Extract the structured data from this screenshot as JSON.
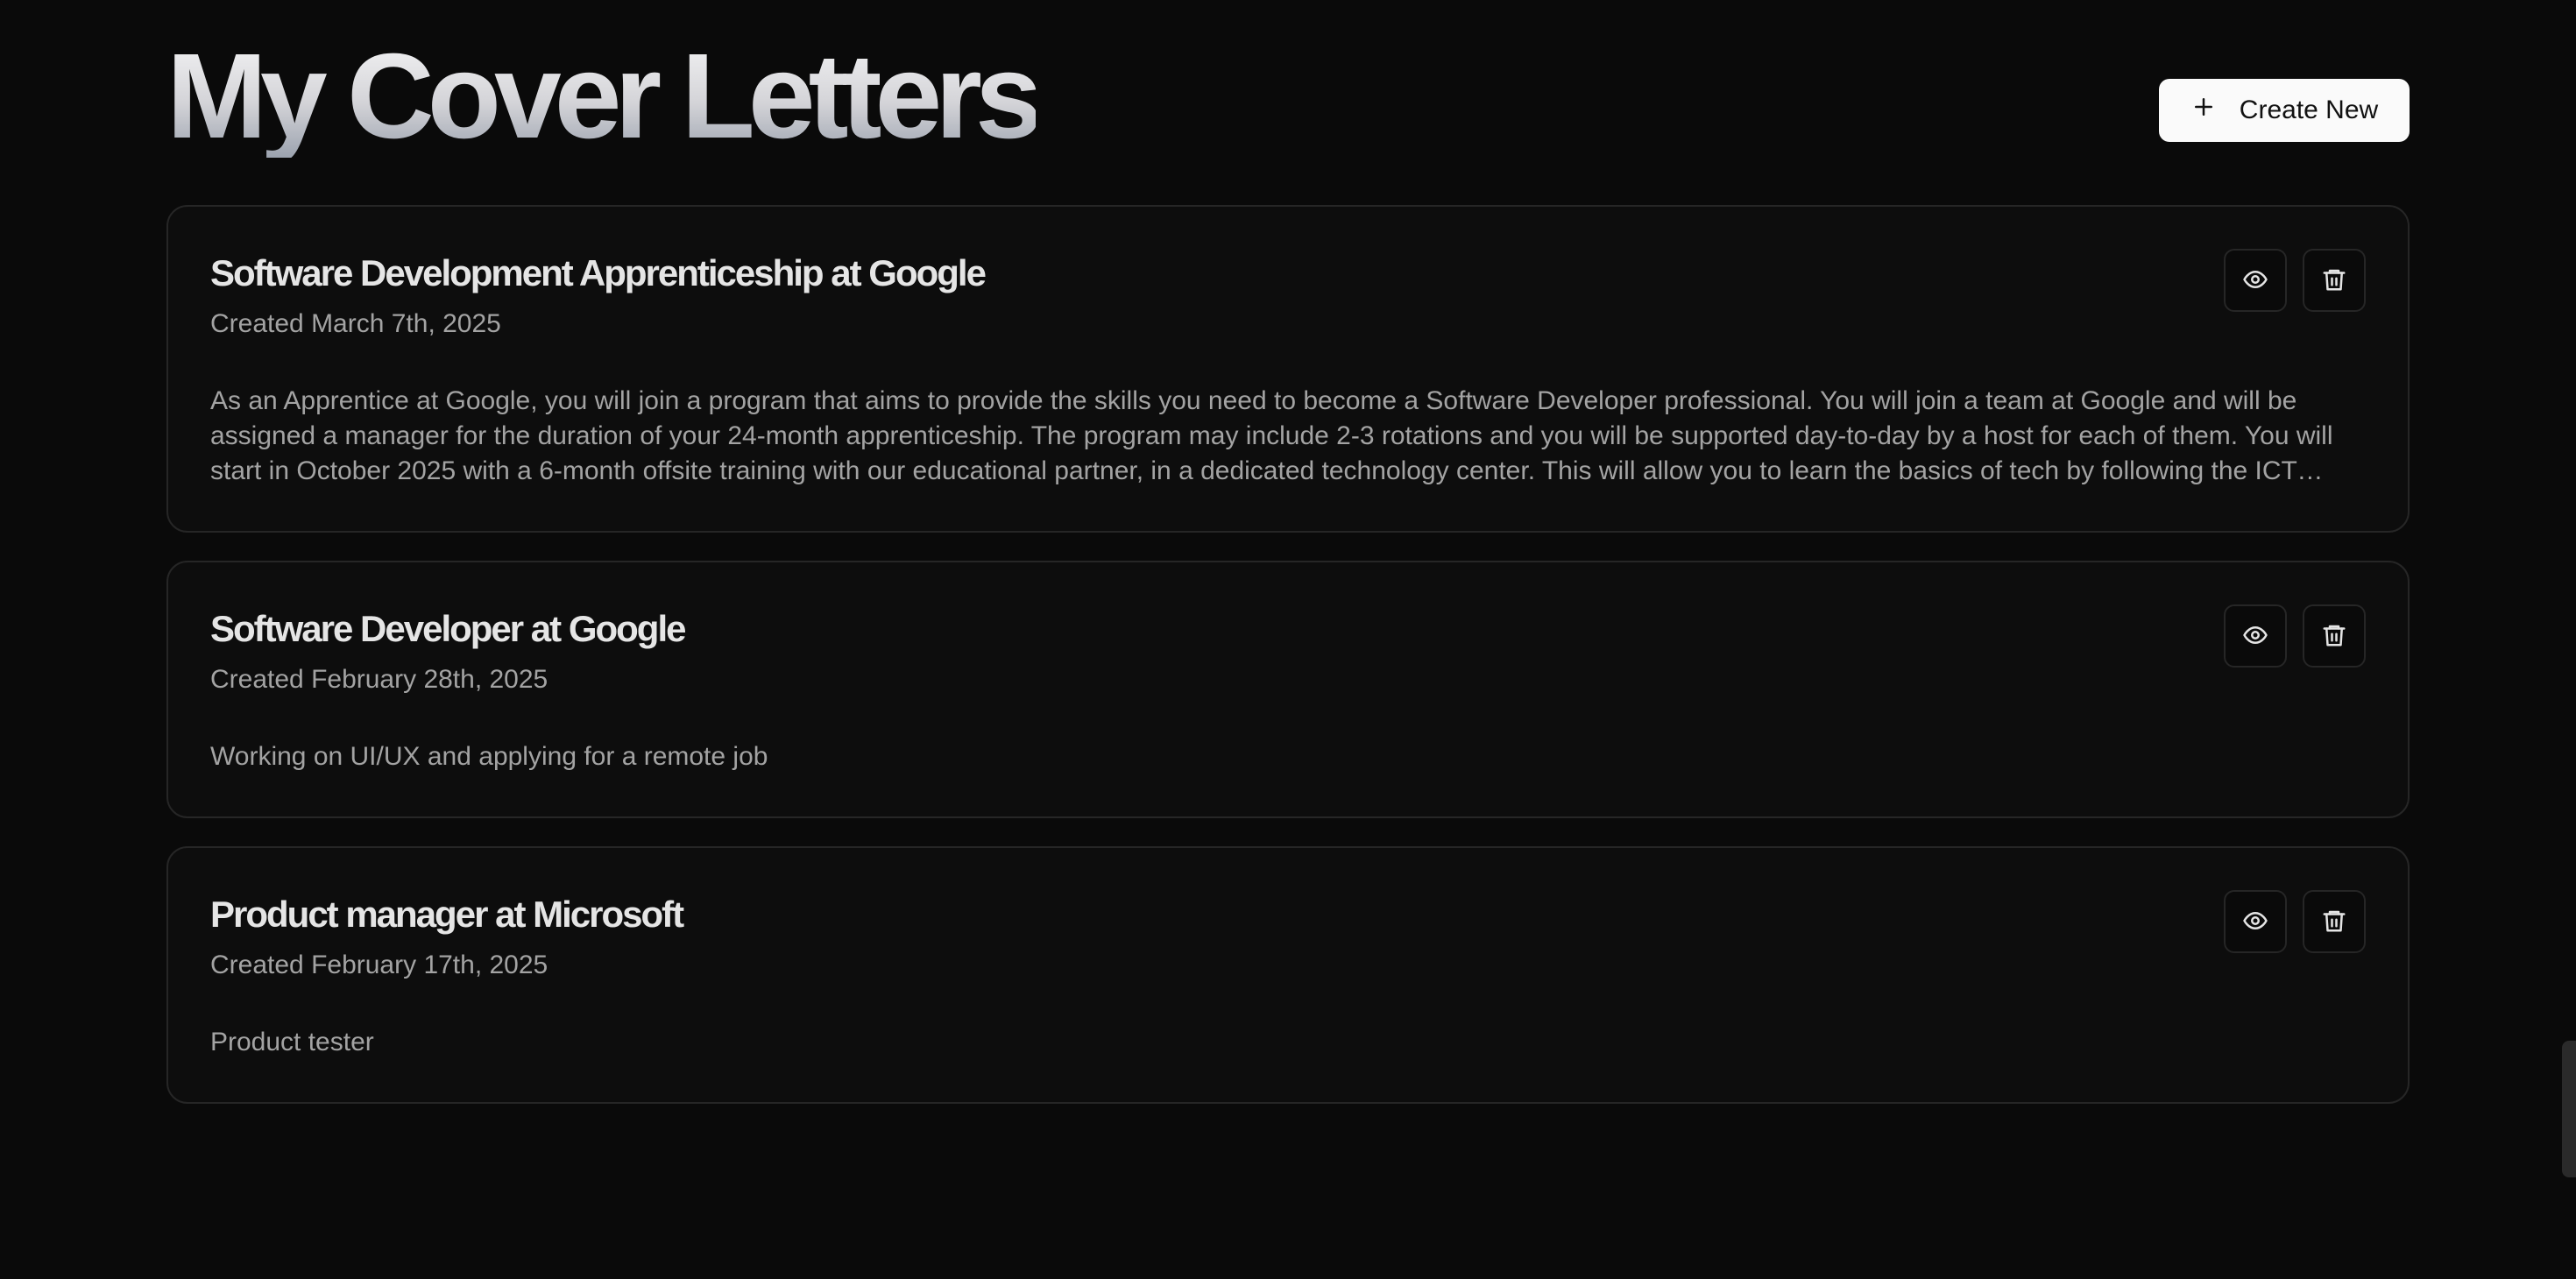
{
  "header": {
    "title": "My Cover Letters",
    "create_button": {
      "label": "Create New",
      "icon": "plus-icon"
    }
  },
  "letters": [
    {
      "title": "Software Development Apprenticeship at Google",
      "created": "Created March 7th, 2025",
      "description": "As an Apprentice at Google, you will join a program that aims to provide the skills you need to become a Software Developer professional. You will join a team at Google and will be assigned a manager for the duration of your 24-month apprenticeship. The program may include 2-3 rotations and you will be supported day-to-day by a host for each of them. You will start in October 2025 with a 6-month offsite training with our educational partner, in a dedicated technology center. This will allow you to learn the basics of tech by following the ICT curriculum."
    },
    {
      "title": "Software Developer at Google",
      "created": "Created February 28th, 2025",
      "description": "Working on UI/UX and applying for a remote job"
    },
    {
      "title": "Product manager at Microsoft",
      "created": "Created February 17th, 2025",
      "description": "Product tester"
    }
  ],
  "icons": {
    "view": "eye-icon",
    "delete": "trash-icon"
  },
  "colors": {
    "background": "#0a0a0a",
    "card_border": "#262626",
    "primary_button": "#fafafa",
    "muted_text": "#a3a3a3"
  }
}
